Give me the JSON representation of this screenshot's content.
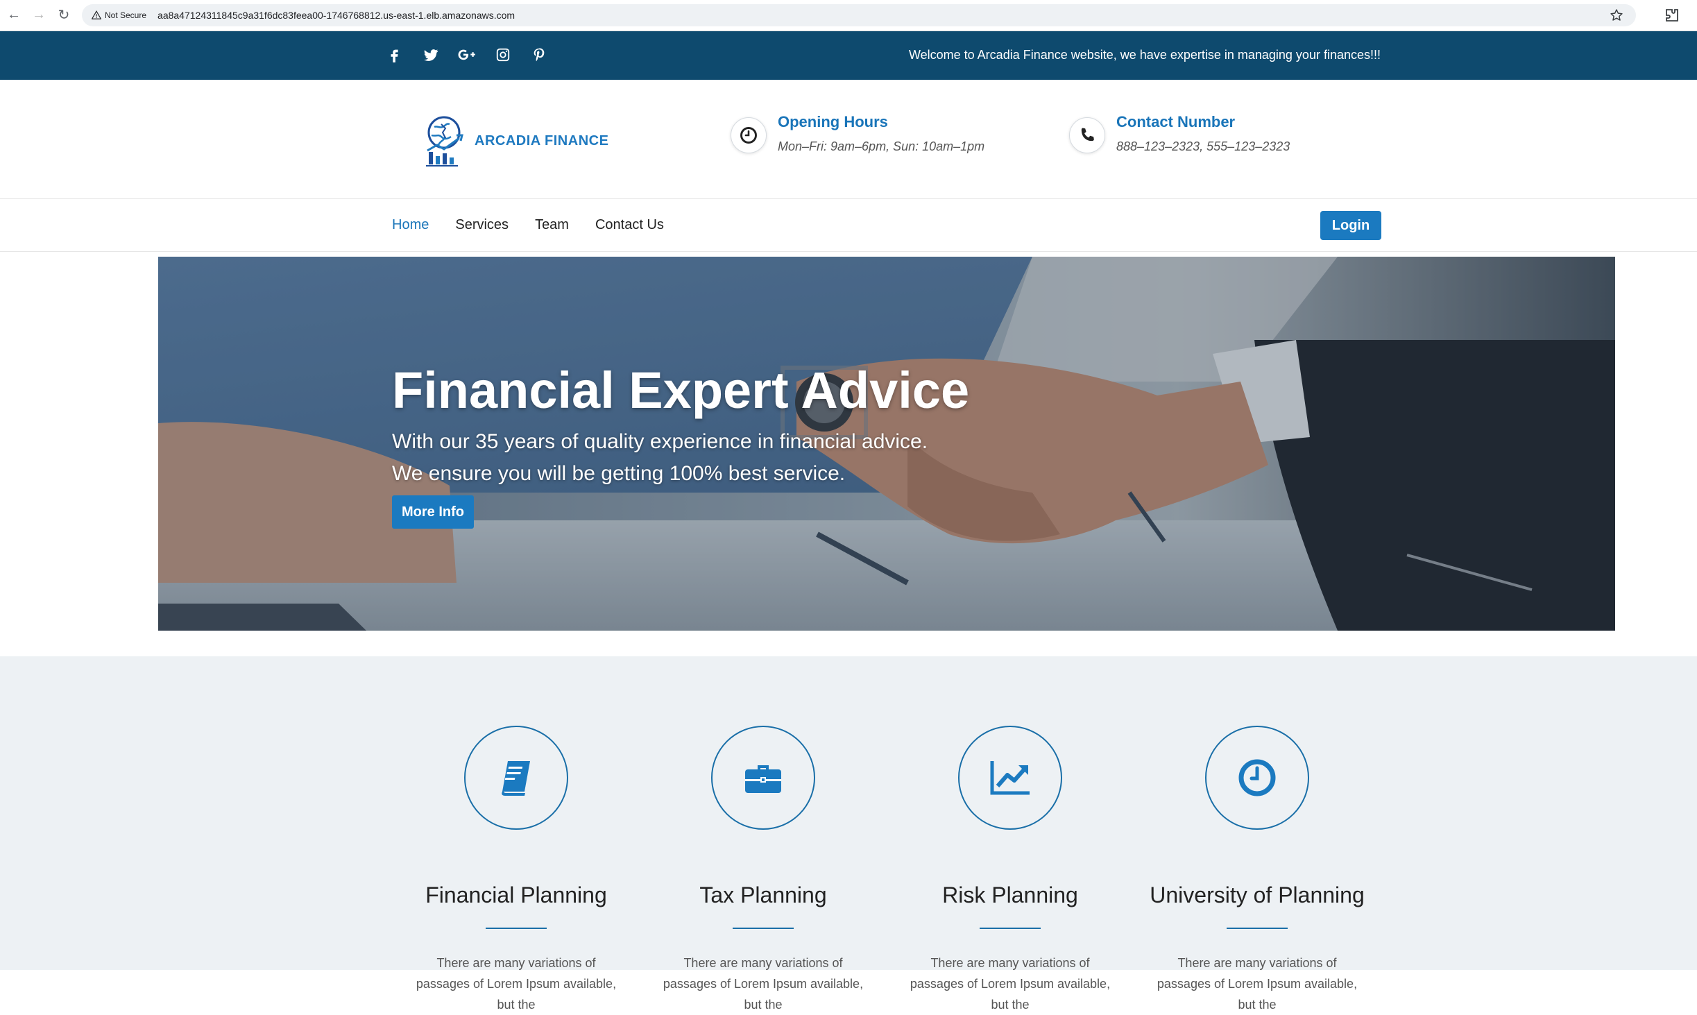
{
  "browser": {
    "security_label": "Not Secure",
    "url": "aa8a47124311845c9a31f6dc83feea00-1746768812.us-east-1.elb.amazonaws.com"
  },
  "top_bar": {
    "social_icons": [
      "facebook-icon",
      "twitter-icon",
      "google-plus-icon",
      "instagram-icon",
      "pinterest-icon"
    ],
    "welcome": "Welcome to Arcadia Finance website, we have expertise in managing your finances!!!"
  },
  "header": {
    "logo_text": "ARCADIA FINANCE",
    "opening_hours": {
      "title": "Opening Hours",
      "value": "Mon–Fri: 9am–6pm, Sun: 10am–1pm"
    },
    "contact": {
      "title": "Contact Number",
      "value": "888–123–2323, 555–123–2323"
    }
  },
  "nav": {
    "links": [
      "Home",
      "Services",
      "Team",
      "Contact Us"
    ],
    "active": "Home",
    "login": "Login"
  },
  "hero": {
    "title": "Financial Expert Advice",
    "line1": "With our 35 years of quality experience in financial advice.",
    "line2": "We ensure you will be getting 100% best service.",
    "button": "More Info"
  },
  "services": [
    {
      "icon": "book-icon",
      "title": "Financial Planning",
      "desc": "There are many variations of passages of Lorem Ipsum available, but the"
    },
    {
      "icon": "briefcase-icon",
      "title": "Tax Planning",
      "desc": "There are many variations of passages of Lorem Ipsum available, but the"
    },
    {
      "icon": "chart-line-icon",
      "title": "Risk Planning",
      "desc": "There are many variations of passages of Lorem Ipsum available, but the"
    },
    {
      "icon": "clock-icon",
      "title": "University of Planning",
      "desc": "There are many variations of passages of Lorem Ipsum available, but the"
    }
  ],
  "colors": {
    "brand_blue": "#1b7ac0",
    "top_bar": "#0e4a6e",
    "services_bg": "#edf1f4"
  }
}
